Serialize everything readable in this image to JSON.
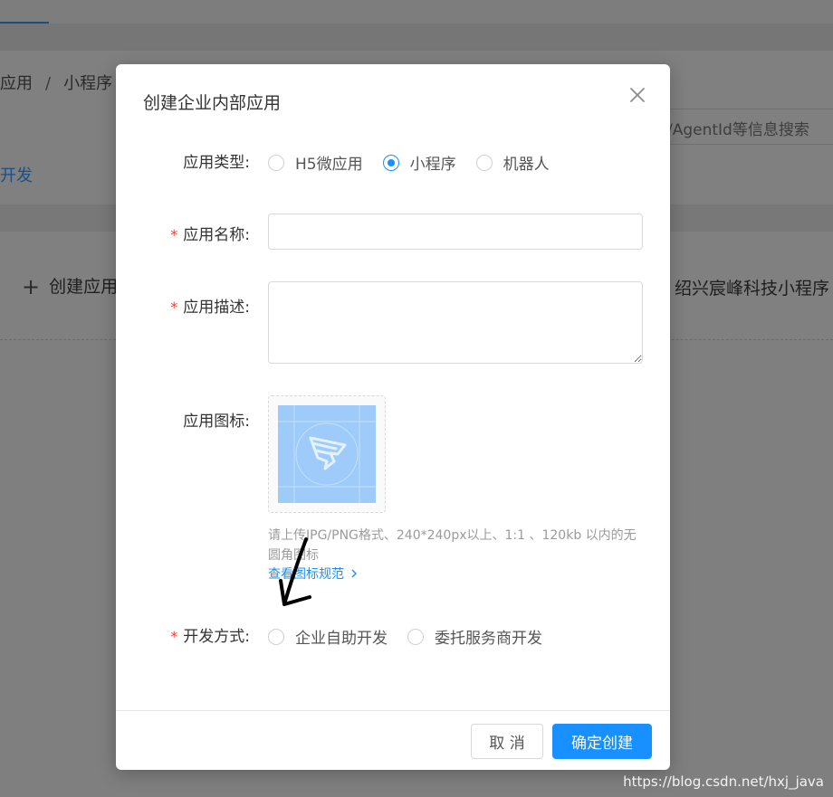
{
  "background": {
    "breadcrumb": [
      "应用",
      "/",
      "小程序"
    ],
    "side_link": "开发",
    "search_placeholder": "/AgentId等信息搜索",
    "create_app_label": "创建应用",
    "app_name": "绍兴宸峰科技小程序"
  },
  "modal": {
    "title": "创建企业内部应用",
    "fields": {
      "app_type": {
        "label": "应用类型:",
        "options": [
          "H5微应用",
          "小程序",
          "机器人"
        ],
        "selected": "小程序"
      },
      "app_name": {
        "label": "应用名称:",
        "value": "",
        "placeholder": ""
      },
      "app_desc": {
        "label": "应用描述:",
        "value": "",
        "placeholder": ""
      },
      "app_icon": {
        "label": "应用图标:",
        "hint": "请上传JPG/PNG格式、240*240px以上、1:1 、120kb 以内的无圆角图标",
        "link": "查看图标规范"
      },
      "dev_mode": {
        "label": "开发方式:",
        "options": [
          "企业自助开发",
          "委托服务商开发"
        ],
        "selected": ""
      }
    },
    "required_mark": "*",
    "buttons": {
      "cancel": "取 消",
      "confirm": "确定创建"
    }
  },
  "watermark": "https://blog.csdn.net/hxj_java",
  "colors": {
    "primary": "#1890ff",
    "required": "#f04134",
    "overlay": "#808080"
  }
}
